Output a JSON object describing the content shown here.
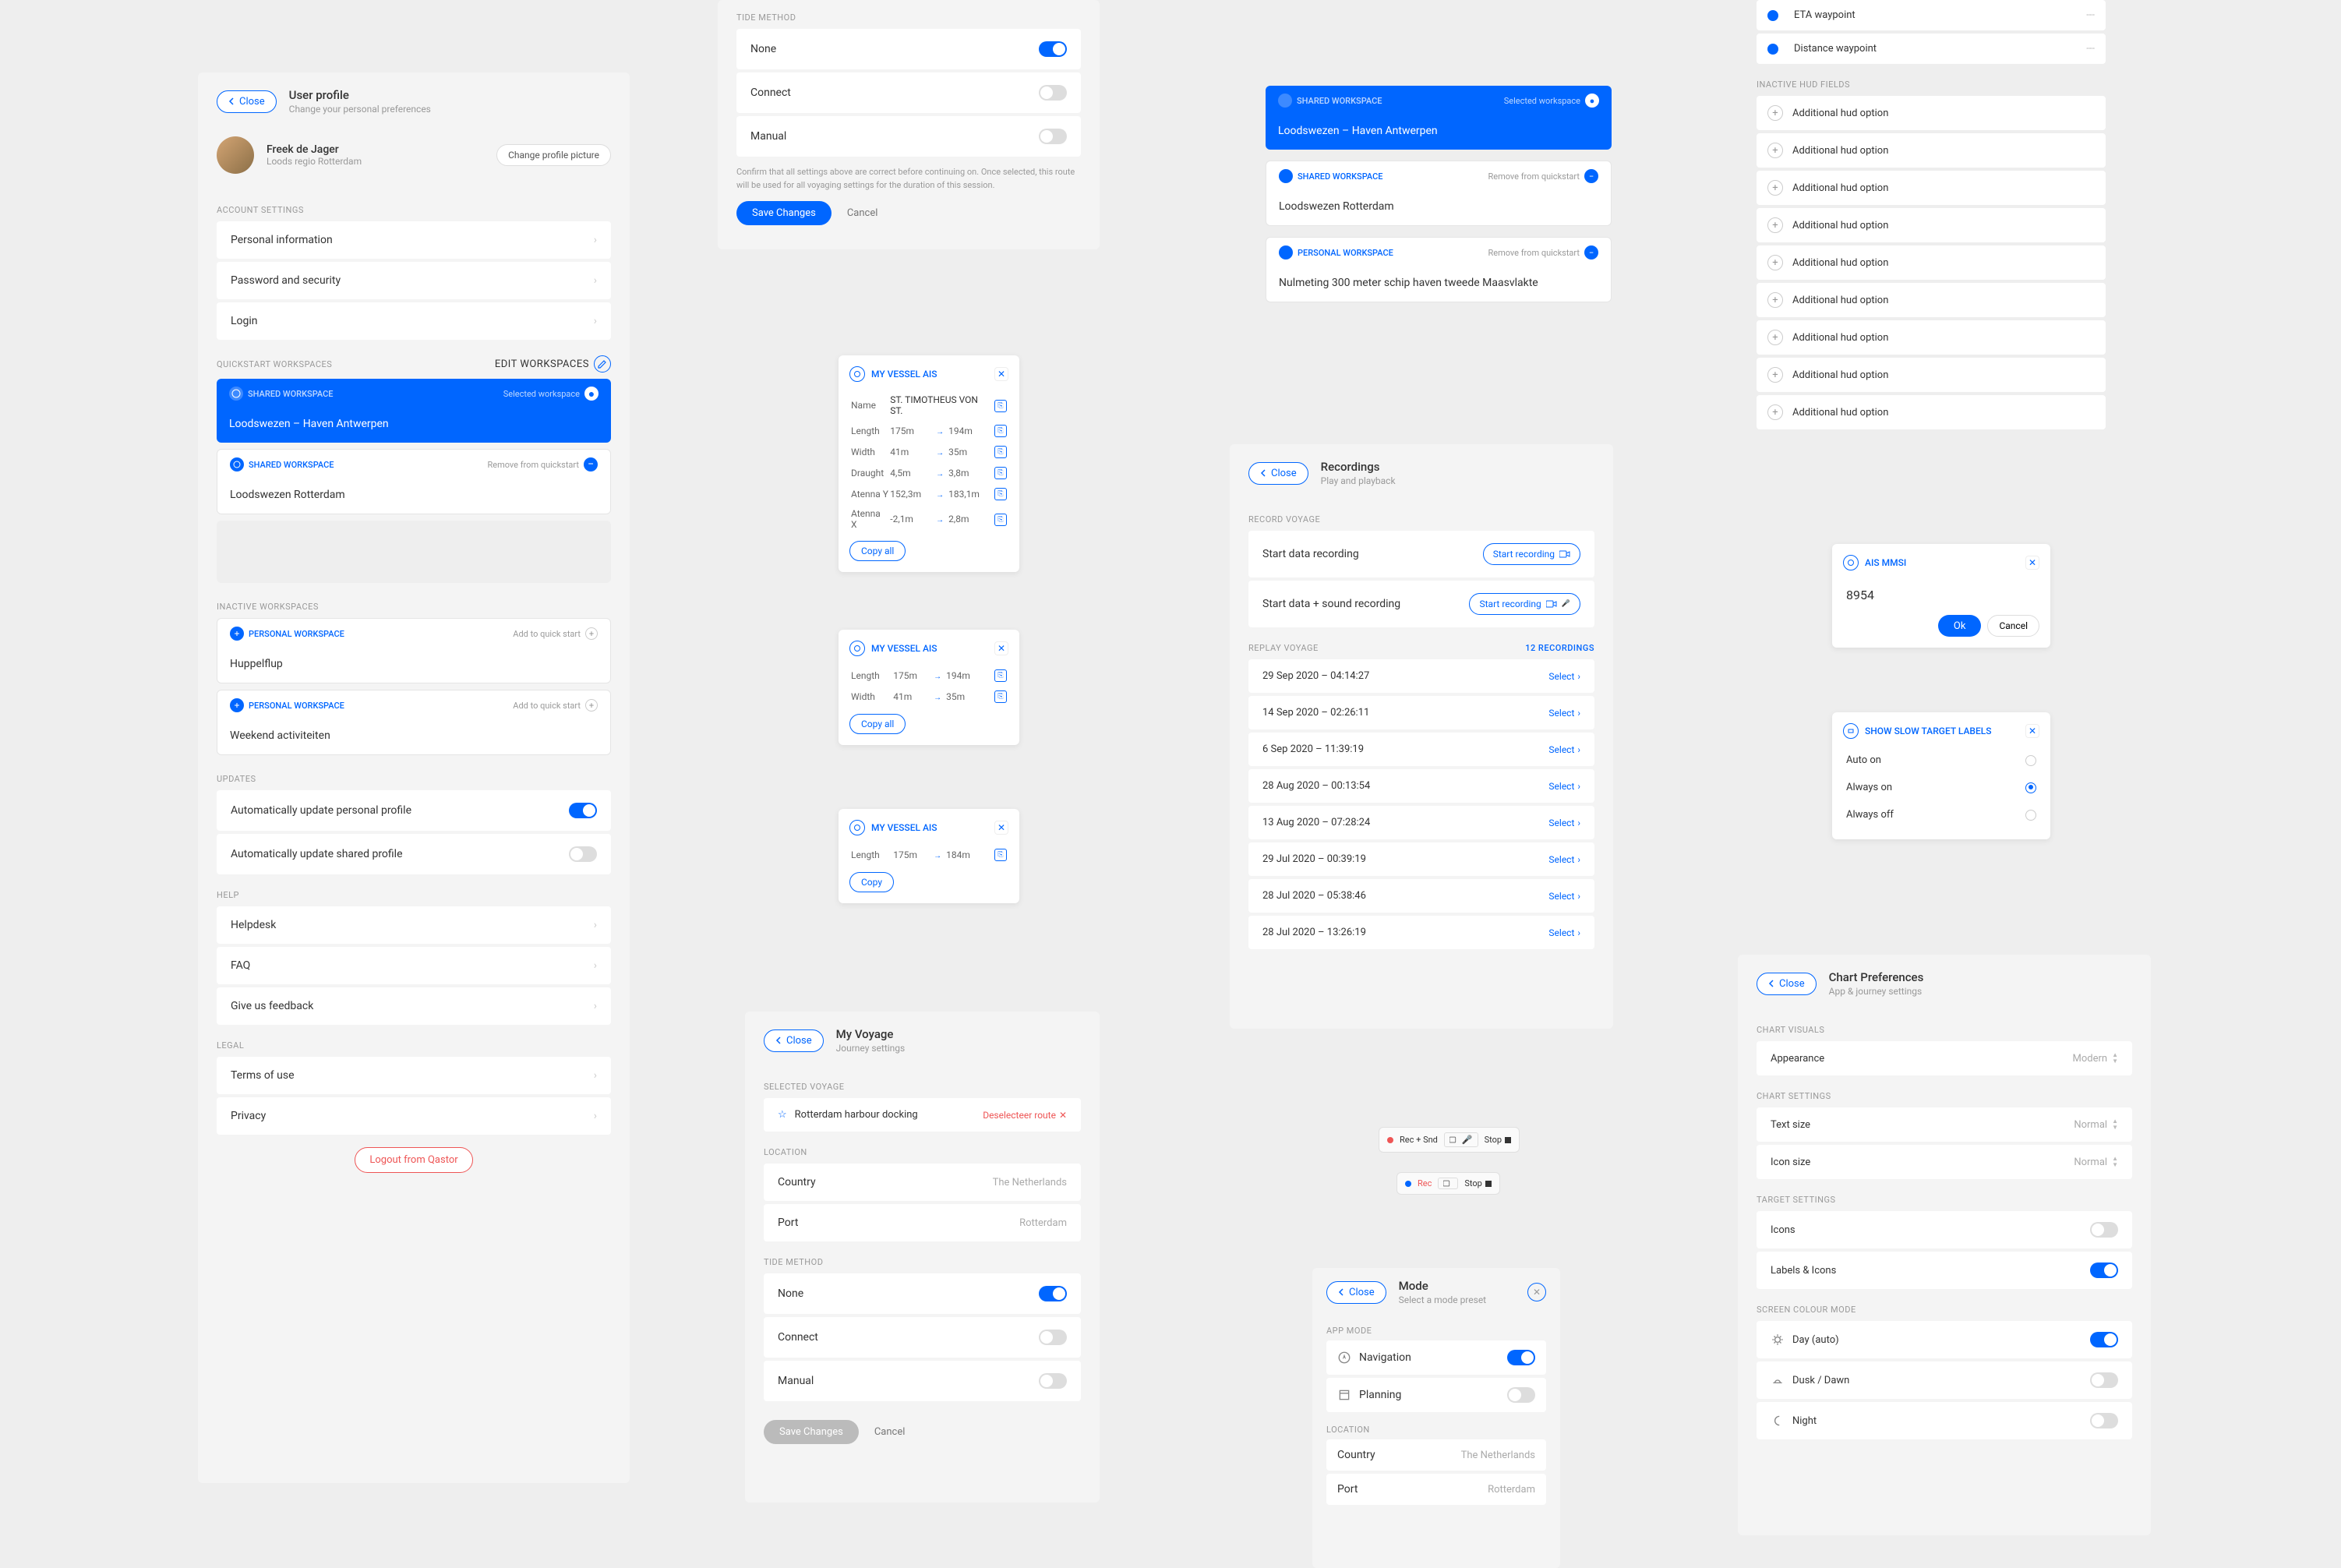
{
  "userProfile": {
    "closeLabel": "Close",
    "title": "User profile",
    "subtitle": "Change your personal preferences",
    "name": "Freek de Jager",
    "role": "Loods regio Rotterdam",
    "changePictureLabel": "Change profile picture",
    "accountSettingsLabel": "ACCOUNT SETTINGS",
    "accountItems": [
      "Personal information",
      "Password and security",
      "Login"
    ],
    "quickstartLabel": "QUICKSTART WORKSPACES",
    "editWorkspacesLabel": "Edit Workspaces",
    "sharedWorkspaceLabel": "SHARED WORKSPACE",
    "selectedWorkspaceLabel": "Selected workspace",
    "ws1Name": "Loodswezen – Haven Antwerpen",
    "removeFromQuickstartLabel": "Remove from quickstart",
    "ws2Name": "Loodswezen Rotterdam",
    "inactiveWorkspacesLabel": "INACTIVE WORKSPACES",
    "personalWorkspaceLabel": "PERSONAL WORKSPACE",
    "addToQuickStartLabel": "Add to quick start",
    "iw1Name": "Huppelflup",
    "iw2Name": "Weekend activiteiten",
    "updatesLabel": "UPDATES",
    "updatePersonal": "Automatically update personal profile",
    "updateShared": "Automatically update shared profile",
    "helpLabel": "HELP",
    "helpItems": [
      "Helpdesk",
      "FAQ",
      "Give us feedback"
    ],
    "legalLabel": "LEGAL",
    "legalItems": [
      "Terms of use",
      "Privacy"
    ],
    "logoutLabel": "Logout from Qastor"
  },
  "tideMethod": {
    "label": "TIDE METHOD",
    "options": [
      "None",
      "Connect",
      "Manual"
    ],
    "infoText": "Confirm that all settings above are correct before continuing on. Once selected, this route will be used for all voyaging settings for the duration of this session.",
    "saveLabel": "Save Changes",
    "cancelLabel": "Cancel"
  },
  "vesselAis": {
    "title": "MY VESSEL AIS",
    "card1": {
      "rows": [
        [
          "Name",
          "ST. TIMOTHEUS VON ST.",
          ""
        ],
        [
          "Length",
          "175m",
          "194m"
        ],
        [
          "Width",
          "41m",
          "35m"
        ],
        [
          "Draught",
          "4,5m",
          "3,8m"
        ],
        [
          "Atenna Y",
          "152,3m",
          "183,1m"
        ],
        [
          "Atenna X",
          "-2,1m",
          "2,8m"
        ]
      ],
      "copyAllLabel": "Copy all"
    },
    "card2": {
      "rows": [
        [
          "Length",
          "175m",
          "194m"
        ],
        [
          "Width",
          "41m",
          "35m"
        ]
      ],
      "copyAllLabel": "Copy all"
    },
    "card3": {
      "rows": [
        [
          "Length",
          "175m",
          "184m"
        ]
      ],
      "copyLabel": "Copy"
    }
  },
  "myVoyage": {
    "closeLabel": "Close",
    "title": "My Voyage",
    "subtitle": "Journey settings",
    "selectedVoyageLabel": "SELECTED VOYAGE",
    "routeName": "Rotterdam harbour docking",
    "deselectLabel": "Deselecteer route",
    "locationLabel": "LOCATION",
    "countryLabel": "Country",
    "countryValue": "The Netherlands",
    "portLabel": "Port",
    "portValue": "Rotterdam",
    "tideMethodLabel": "TIDE METHOD",
    "tideOptions": [
      "None",
      "Connect",
      "Manual"
    ],
    "saveLabel": "Save Changes",
    "cancelLabel": "Cancel"
  },
  "workspaceCards": {
    "sharedLabel": "SHARED WORKSPACE",
    "selectedLabel": "Selected workspace",
    "ws1Name": "Loodswezen – Haven Antwerpen",
    "removeLabel": "Remove from quickstart",
    "ws2Name": "Loodswezen Rotterdam",
    "personalLabel": "PERSONAL WORKSPACE",
    "removeLabel2": "Remove from quickstart",
    "ws3Name": "Nulmeting 300 meter schip haven tweede Maasvlakte"
  },
  "recordings": {
    "closeLabel": "Close",
    "title": "Recordings",
    "subtitle": "Play and playback",
    "recordVoyageLabel": "RECORD VOYAGE",
    "startDataLabel": "Start data recording",
    "startDataSoundLabel": "Start data + sound recording",
    "startRecordingLabel": "Start recording",
    "replayVoyageLabel": "REPLAY VOYAGE",
    "recordingsCount": "12 RECORDINGS",
    "items": [
      "29 Sep 2020 –  04:14:27",
      "14 Sep 2020 – 02:26:11",
      "6 Sep 2020 – 11:39:19",
      "28 Aug 2020 – 00:13:54",
      "13 Aug 2020 – 07:28:24",
      "29 Jul 2020 – 00:39:19",
      "28 Jul 2020 – 05:38:46",
      "28 Jul 2020 – 13:26:19"
    ],
    "selectLabel": "Select"
  },
  "recPills": {
    "recSnd": "Rec + Snd",
    "rec": "Rec",
    "stop": "Stop"
  },
  "mode": {
    "closeLabel": "Close",
    "title": "Mode",
    "subtitle": "Select a mode preset",
    "appModeLabel": "APP MODE",
    "navLabel": "Navigation",
    "planLabel": "Planning",
    "locationLabel": "LOCATION",
    "countryLabel": "Country",
    "countryValue": "The Netherlands",
    "portLabel": "Port",
    "portValue": "Rotterdam"
  },
  "hudFields": {
    "activeItems": [
      "ETA waypoint",
      "Distance waypoint"
    ],
    "activeTags": [
      "---",
      "---"
    ],
    "inactiveLabel": "INACTIVE HUD FIELDS",
    "inactiveItem": "Additional hud option"
  },
  "aisMmsi": {
    "title": "AIS MMSI",
    "value": "8954",
    "okLabel": "Ok",
    "cancelLabel": "Cancel"
  },
  "showSlow": {
    "title": "SHOW SLOW TARGET LABELS",
    "options": [
      "Auto on",
      "Always on",
      "Always off"
    ]
  },
  "chartPrefs": {
    "closeLabel": "Close",
    "title": "Chart Preferences",
    "subtitle": "App & journey settings",
    "chartVisualsLabel": "CHART VISUALS",
    "appearanceLabel": "Appearance",
    "appearanceValue": "Modern",
    "chartSettingsLabel": "CHART SETTINGS",
    "textSizeLabel": "Text size",
    "textSizeValue": "Normal",
    "iconSizeLabel": "Icon size",
    "iconSizeValue": "Normal",
    "targetSettingsLabel": "TARGET SETTINGS",
    "iconsLabel": "Icons",
    "labelsIconsLabel": "Labels & Icons",
    "screenColourLabel": "SCREEN COLOUR MODE",
    "dayLabel": "Day (auto)",
    "duskLabel": "Dusk / Dawn",
    "nightLabel": "Night"
  }
}
